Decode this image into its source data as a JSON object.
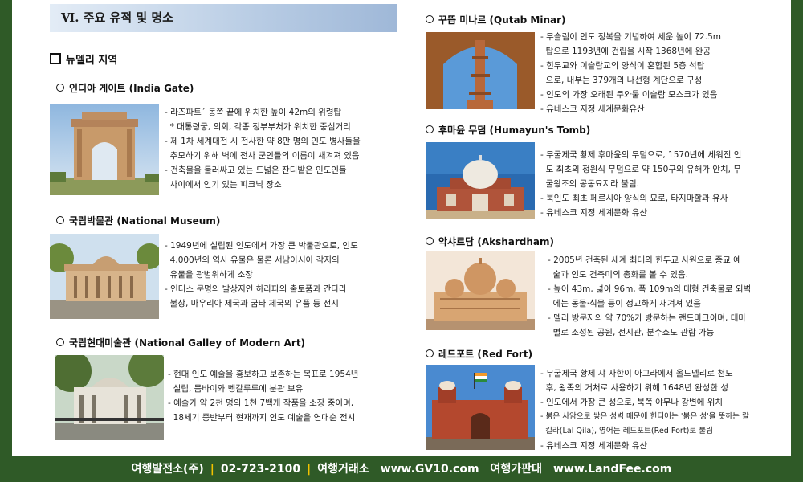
{
  "section_title": "Ⅵ. 주요 유적 및 명소",
  "region_title": "뉴델리 지역",
  "sites": [
    {
      "title": "인디아 게이트 (India Gate)",
      "lines": [
        "- 라즈파트´ 동쪽 끝에 위치한 높이 42m의 위령탑",
        "  * 대통령궁, 의회, 각종 정부부처가 위치한 중심거리",
        "- 제 1차 세계대전 시 전사한 약 8만 명의 인도 병사들을",
        "  추모하기 위해 벽에 전사 군인들의 이름이 새겨져 있음",
        "- 건축물을 둘러싸고 있는 드넓은 잔디밭은 인도인들",
        "  사이에서 인기 있는 피크닉 장소"
      ]
    },
    {
      "title": "국립박물관 (National Museum)",
      "lines": [
        "- 1949년에 설립된 인도에서 가장 큰 박물관으로, 인도",
        "  4,000년의 역사 유물은 물론 서남아시아 각지의",
        "  유물을 광범위하게 소장",
        "- 인더스 문명의 발상지인 하라파의 출토품과 간다라",
        "  불상, 마우리아 제국과 굽타 제국의 유품 등 전시"
      ]
    },
    {
      "title": "국립현대미술관 (National Galley of Modern Art)",
      "lines": [
        "- 현대 인도 예술을 홍보하고 보존하는 목표로 1954년",
        "  설립, 뭄바이와 벵갈루루에 분관 보유",
        "- 예술가 약 2천 명의 1천 7백개 작품을 소장 중이며,",
        "  18세기 중반부터 현재까지 인도 예술을 연대순 전시"
      ]
    },
    {
      "title": "꾸뜹 미나르 (Qutab Minar)",
      "lines": [
        "- 무슬림이 인도 정복을 기념하여 세운 높이 72.5m",
        "  탑으로 1193년에 건립을 시작 1368년에 완공",
        "- 힌두교와 이슬람교의 양식이 혼합된 5층 석탑",
        "  으로, 내부는 379개의 나선형 계단으로 구성",
        "- 인도의 가장 오래된 쿠와툴 이슬람 모스크가 있음",
        "- 유네스코 지정 세계문화유산"
      ]
    },
    {
      "title": "후마윤 무덤 (Humayun's Tomb)",
      "lines": [
        "- 무굴제국 황제 후마윤의 무덤으로, 1570년에 세워진 인",
        "  도 최초의 정원식 무덤으로 약 150구의 유해가 안치, 무",
        "  굴왕조의 공동묘지라 불림.",
        "- 북인도 최초 페르시아 양식의 묘로, 타지마할과 유사",
        "- 유네스코 지정 세계문화 유산"
      ]
    },
    {
      "title": "악샤르담 (Akshardham)",
      "lines": [
        "- 2005년 건축된 세계 최대의 힌두교 사원으로 종교 예",
        "  술과 인도 건축미의 총화를 볼 수 있음.",
        "- 높이 43m, 넓이 96m, 폭 109m의 대형 건축물로 외벽",
        "  에는 동물·식물 등이 정교하게 새겨져 있음",
        "- 델리 방문자의 약 70%가 방문하는 랜드마크이며, 테마",
        "  별로 조성된 공원, 전시관, 분수쇼도 관람 가능"
      ]
    },
    {
      "title": "레드포트 (Red Fort)",
      "lines": [
        "- 무굴제국 황제 샤 자한이 아그라에서 올드델리로 천도",
        "  후, 왕족의 거처로 사용하기 위해 1648년 완성한 성",
        "- 인도에서 가장 큰 성으로, 북쪽 야무나 강변에 위치",
        "- 붉은 사암으로 쌓은 성벽 때문에 힌디어는 '붉은 성'을 뜻하는 랄",
        "  킬라(Lal Qila), 영어는 레드포트(Red Fort)로 불림",
        "- 유네스코 지정 세계문화 유산"
      ]
    }
  ],
  "footer": {
    "company": "여행발전소(주)",
    "phone": "02-723-2100",
    "label1": "여행거래소",
    "url1": "www.GV10.com",
    "label2": "여행가판대",
    "url2": "www.LandFee.com"
  },
  "colors": {
    "background": "#2f5a27",
    "header_band": "#b8cce4",
    "footer_separator": "#f2c200"
  }
}
